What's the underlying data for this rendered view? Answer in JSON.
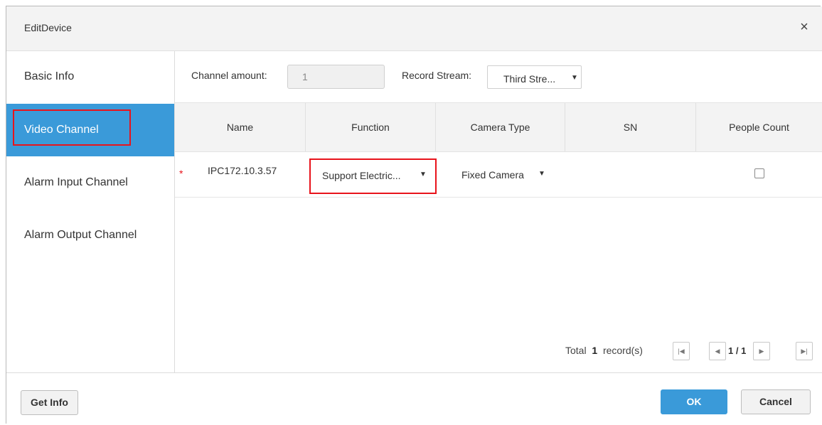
{
  "dialog": {
    "title": "EditDevice",
    "close_icon": "×"
  },
  "sidebar": {
    "items": [
      {
        "label": "Basic Info"
      },
      {
        "label": "Video Channel"
      },
      {
        "label": "Alarm Input Channel"
      },
      {
        "label": "Alarm Output Channel"
      }
    ],
    "active_index": 1
  },
  "top": {
    "channel_amount_label": "Channel amount:",
    "channel_amount_value": "1",
    "record_stream_label": "Record Stream:",
    "record_stream_value": "Third Stre...",
    "caret": "▼"
  },
  "table": {
    "columns": [
      "Name",
      "Function",
      "Camera Type",
      "SN",
      "People Count"
    ],
    "rows": [
      {
        "required_mark": "*",
        "name": "IPC172.10.3.57",
        "function": "Support Electric...",
        "camera_type": "Fixed Camera",
        "sn": "",
        "people_count": false
      }
    ]
  },
  "pager": {
    "total_prefix": "Total",
    "total_count": "1",
    "total_suffix": "record(s)",
    "page": "1 / 1",
    "first_icon": "|◀",
    "prev_icon": "◀",
    "next_icon": "▶",
    "last_icon": "▶|"
  },
  "footer": {
    "get_info": "Get Info",
    "ok": "OK",
    "cancel": "Cancel"
  },
  "colors": {
    "accent": "#3a9ad9",
    "highlight": "#e8131b"
  }
}
